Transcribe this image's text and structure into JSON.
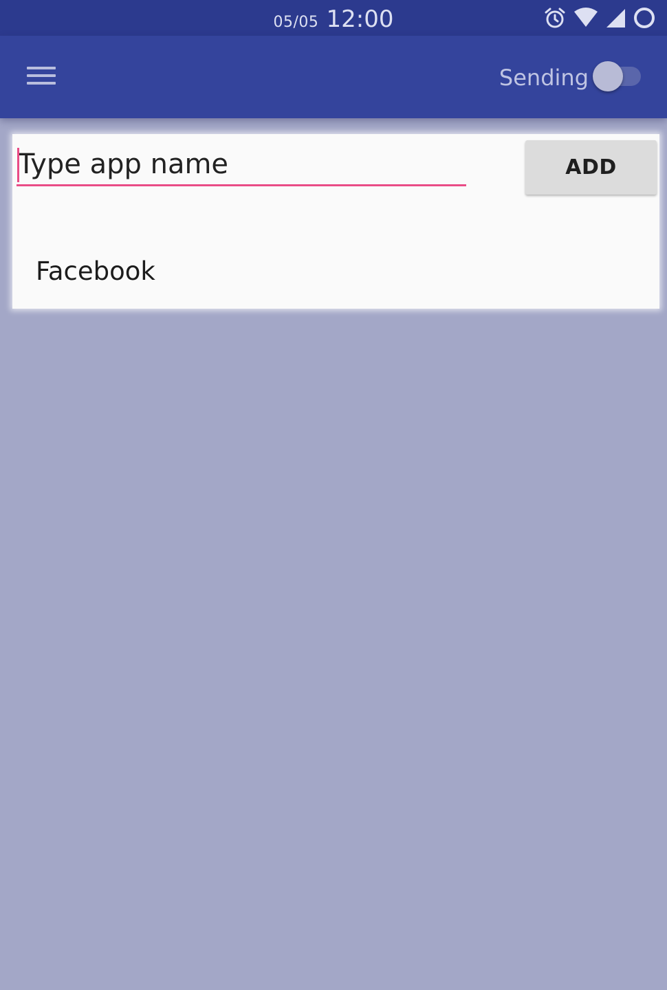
{
  "status_bar": {
    "date": "05/05",
    "time": "12:00",
    "icons": [
      "alarm-icon",
      "wifi-icon",
      "signal-icon",
      "battery-icon"
    ]
  },
  "app_bar": {
    "menu_icon": "menu-icon",
    "sending_label": "Sending",
    "sending_enabled": false
  },
  "input": {
    "placeholder": "Type app name",
    "value": ""
  },
  "add_button": {
    "label": "ADD"
  },
  "app_list": {
    "items": [
      {
        "label": "Facebook"
      }
    ]
  },
  "colors": {
    "status_bar": "#2c3a8e",
    "app_bar": "#34449c",
    "accent": "#e94c86",
    "background": "#a3a7c7",
    "card": "#fafafa"
  }
}
